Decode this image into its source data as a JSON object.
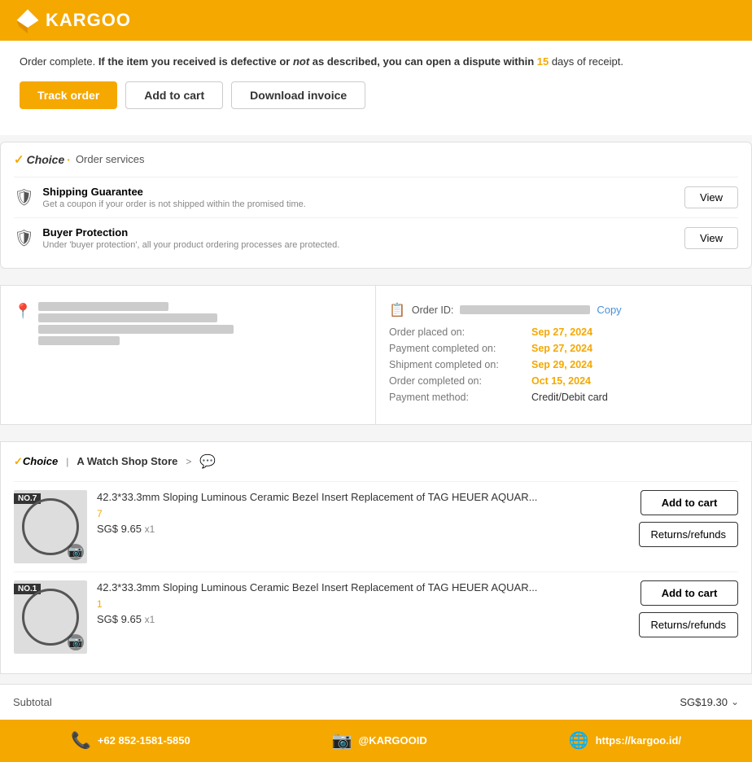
{
  "header": {
    "logo_text": "KARGOO"
  },
  "notice": {
    "text_pre": "Order complete.",
    "text_mid": "If the item you received is defective or ",
    "not_text": "not",
    "text_post": " as described, you can open a dispute within ",
    "days": "15",
    "text_end": " days of receipt."
  },
  "buttons": {
    "track_order": "Track order",
    "add_to_cart": "Add to cart",
    "download_invoice": "Download invoice"
  },
  "choice_section": {
    "badge_check": "✓",
    "badge_word": "Choice",
    "badge_dot": "·",
    "title": "Order services",
    "items": [
      {
        "title": "Shipping Guarantee",
        "desc": "Get a coupon if your order is not shipped within the promised time.",
        "button": "View"
      },
      {
        "title": "Buyer Protection",
        "desc": "Under 'buyer protection', all your product ordering processes are protected.",
        "button": "View"
      }
    ]
  },
  "order_info": {
    "order_id_label": "Order ID:",
    "order_id_value": "[REDACTED]",
    "copy_label": "Copy",
    "details": [
      {
        "label": "Order placed on:",
        "value": "Sep 27, 2024",
        "colored": true
      },
      {
        "label": "Payment completed on:",
        "value": "Sep 27, 2024",
        "colored": true
      },
      {
        "label": "Shipment completed on:",
        "value": "Sep 29, 2024",
        "colored": true
      },
      {
        "label": "Order completed on:",
        "value": "Oct 15, 2024",
        "colored": true
      },
      {
        "label": "Payment method:",
        "value": "Credit/Debit card",
        "colored": false
      }
    ]
  },
  "store": {
    "badge_check": "✓",
    "badge_word": "Choice",
    "separator": "|",
    "name": "A Watch Shop Store",
    "arrow": ">",
    "products": [
      {
        "badge": "NO.7",
        "title": "42.3*33.3mm Sloping Luminous Ceramic Bezel Insert Replacement of TAG HEUER AQUAR...",
        "variant": "7",
        "price": "SG$ 9.65",
        "qty": "x1",
        "add_to_cart": "Add to cart",
        "returns": "Returns/refunds"
      },
      {
        "badge": "NO.1",
        "title": "42.3*33.3mm Sloping Luminous Ceramic Bezel Insert Replacement of TAG HEUER AQUAR...",
        "variant": "1",
        "price": "SG$ 9.65",
        "qty": "x1",
        "add_to_cart": "Add to cart",
        "returns": "Returns/refunds"
      }
    ]
  },
  "subtotal": {
    "label": "Subtotal",
    "value": "SG$19.30"
  },
  "footer": {
    "phone_icon": "📞",
    "phone": "+62 852-1581-5850",
    "instagram_icon": "📷",
    "instagram": "@KARGOOID",
    "globe_icon": "🌐",
    "website": "https://kargoo.id/"
  }
}
